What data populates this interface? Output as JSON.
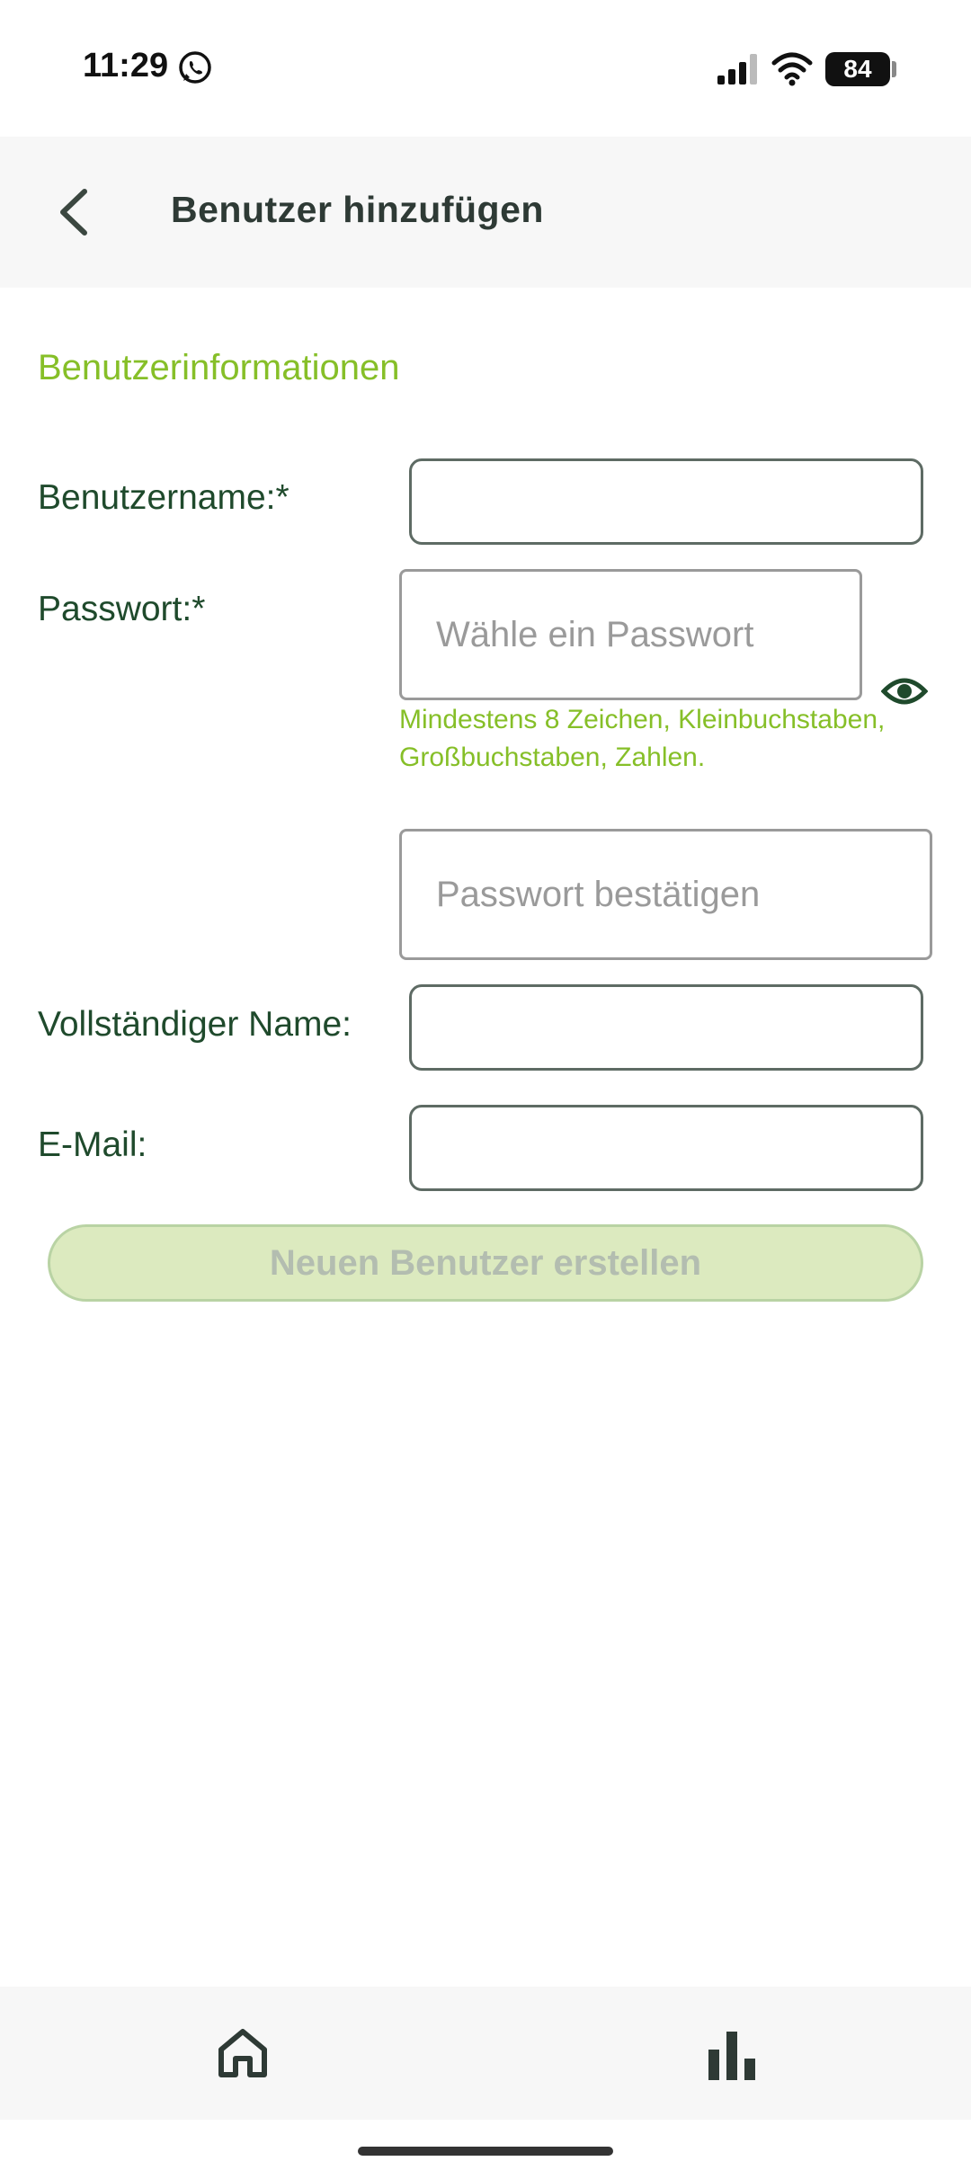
{
  "status_bar": {
    "time": "11:29",
    "battery": "84",
    "icons": [
      "whatsapp-icon",
      "signal-icon",
      "wifi-icon",
      "battery-icon"
    ]
  },
  "header": {
    "title": "Benutzer hinzufügen",
    "back_icon": "chevron-left-icon"
  },
  "form": {
    "section_title": "Benutzerinformationen",
    "username": {
      "label": "Benutzername:*",
      "value": ""
    },
    "password": {
      "label": "Passwort:*",
      "placeholder": "Wähle ein Passwort",
      "hint": "Mindestens 8 Zeichen, Kleinbuchstaben, Großbuchstaben, Zahlen.",
      "toggle_icon": "eye-icon"
    },
    "password_confirm": {
      "placeholder": "Passwort bestätigen"
    },
    "full_name": {
      "label": "Vollständiger Name:",
      "value": ""
    },
    "email": {
      "label": "E-Mail:",
      "value": ""
    },
    "submit_label": "Neuen Benutzer erstellen"
  },
  "bottom_nav": {
    "items": [
      {
        "icon": "home-icon"
      },
      {
        "icon": "bar-chart-icon"
      }
    ]
  },
  "colors": {
    "accent_green": "#86bf28",
    "label_green": "#1f4a2c",
    "button_disabled_bg": "#dceabf",
    "title_dark": "#2e3a35"
  }
}
